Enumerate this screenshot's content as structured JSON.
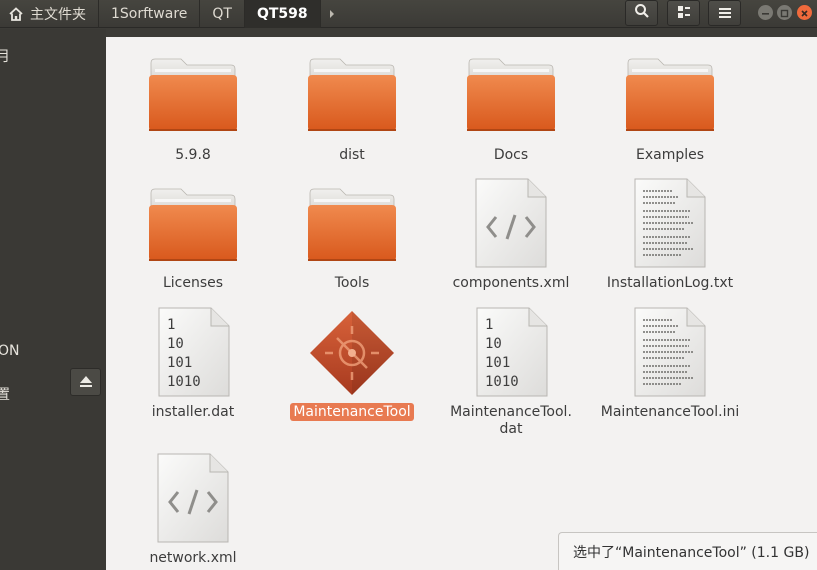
{
  "breadcrumbs": [
    {
      "label": "主文件夹",
      "icon": "home-icon"
    },
    {
      "label": "1Sorftware"
    },
    {
      "label": "QT"
    },
    {
      "label": "QT598",
      "active": true
    }
  ],
  "header_buttons": [
    "search-icon",
    "view-options-icon",
    "menu-icon"
  ],
  "window_controls": [
    "minimize-icon",
    "maximize-icon",
    "close-icon"
  ],
  "sidebar": {
    "fragment_1": "月",
    "fragment_2": "ON",
    "fragment_3": "置"
  },
  "items": [
    {
      "label": "5.9.8",
      "type": "folder"
    },
    {
      "label": "dist",
      "type": "folder"
    },
    {
      "label": "Docs",
      "type": "folder"
    },
    {
      "label": "Examples",
      "type": "folder"
    },
    {
      "label": "Licenses",
      "type": "folder"
    },
    {
      "label": "Tools",
      "type": "folder"
    },
    {
      "label": "components.xml",
      "type": "xml"
    },
    {
      "label": "InstallationLog.txt",
      "type": "text"
    },
    {
      "label": "installer.dat",
      "type": "binary"
    },
    {
      "label": "MaintenanceTool",
      "type": "executable",
      "selected": true
    },
    {
      "label_line1": "MaintenanceTool.",
      "label_line2": "dat",
      "type": "binary"
    },
    {
      "label": "MaintenanceTool.ini",
      "type": "text"
    },
    {
      "label": "network.xml",
      "type": "xml"
    }
  ],
  "binary_lines": [
    "1",
    "10",
    "101",
    "1010"
  ],
  "status_text": "选中了“MaintenanceTool” (1.1 GB)",
  "colors": {
    "accent": "#e95420",
    "folder": "#e8703a",
    "selection": "#e87a51"
  }
}
